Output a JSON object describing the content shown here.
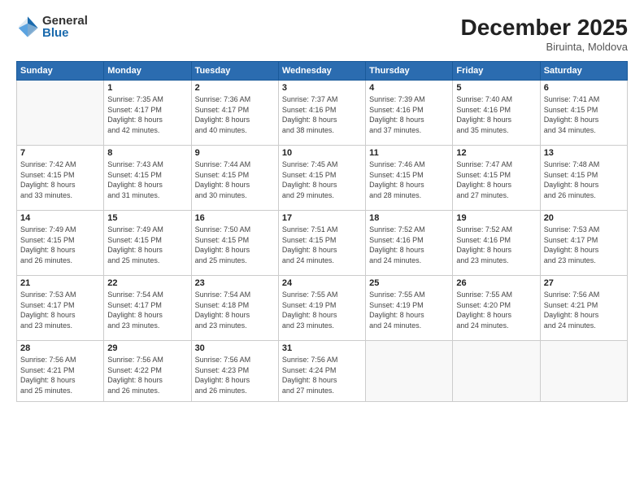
{
  "logo": {
    "general": "General",
    "blue": "Blue"
  },
  "title": "December 2025",
  "location": "Biruinta, Moldova",
  "days_header": [
    "Sunday",
    "Monday",
    "Tuesday",
    "Wednesday",
    "Thursday",
    "Friday",
    "Saturday"
  ],
  "weeks": [
    [
      {
        "day": "",
        "info": ""
      },
      {
        "day": "1",
        "info": "Sunrise: 7:35 AM\nSunset: 4:17 PM\nDaylight: 8 hours\nand 42 minutes."
      },
      {
        "day": "2",
        "info": "Sunrise: 7:36 AM\nSunset: 4:17 PM\nDaylight: 8 hours\nand 40 minutes."
      },
      {
        "day": "3",
        "info": "Sunrise: 7:37 AM\nSunset: 4:16 PM\nDaylight: 8 hours\nand 38 minutes."
      },
      {
        "day": "4",
        "info": "Sunrise: 7:39 AM\nSunset: 4:16 PM\nDaylight: 8 hours\nand 37 minutes."
      },
      {
        "day": "5",
        "info": "Sunrise: 7:40 AM\nSunset: 4:16 PM\nDaylight: 8 hours\nand 35 minutes."
      },
      {
        "day": "6",
        "info": "Sunrise: 7:41 AM\nSunset: 4:15 PM\nDaylight: 8 hours\nand 34 minutes."
      }
    ],
    [
      {
        "day": "7",
        "info": "Sunrise: 7:42 AM\nSunset: 4:15 PM\nDaylight: 8 hours\nand 33 minutes."
      },
      {
        "day": "8",
        "info": "Sunrise: 7:43 AM\nSunset: 4:15 PM\nDaylight: 8 hours\nand 31 minutes."
      },
      {
        "day": "9",
        "info": "Sunrise: 7:44 AM\nSunset: 4:15 PM\nDaylight: 8 hours\nand 30 minutes."
      },
      {
        "day": "10",
        "info": "Sunrise: 7:45 AM\nSunset: 4:15 PM\nDaylight: 8 hours\nand 29 minutes."
      },
      {
        "day": "11",
        "info": "Sunrise: 7:46 AM\nSunset: 4:15 PM\nDaylight: 8 hours\nand 28 minutes."
      },
      {
        "day": "12",
        "info": "Sunrise: 7:47 AM\nSunset: 4:15 PM\nDaylight: 8 hours\nand 27 minutes."
      },
      {
        "day": "13",
        "info": "Sunrise: 7:48 AM\nSunset: 4:15 PM\nDaylight: 8 hours\nand 26 minutes."
      }
    ],
    [
      {
        "day": "14",
        "info": "Sunrise: 7:49 AM\nSunset: 4:15 PM\nDaylight: 8 hours\nand 26 minutes."
      },
      {
        "day": "15",
        "info": "Sunrise: 7:49 AM\nSunset: 4:15 PM\nDaylight: 8 hours\nand 25 minutes."
      },
      {
        "day": "16",
        "info": "Sunrise: 7:50 AM\nSunset: 4:15 PM\nDaylight: 8 hours\nand 25 minutes."
      },
      {
        "day": "17",
        "info": "Sunrise: 7:51 AM\nSunset: 4:15 PM\nDaylight: 8 hours\nand 24 minutes."
      },
      {
        "day": "18",
        "info": "Sunrise: 7:52 AM\nSunset: 4:16 PM\nDaylight: 8 hours\nand 24 minutes."
      },
      {
        "day": "19",
        "info": "Sunrise: 7:52 AM\nSunset: 4:16 PM\nDaylight: 8 hours\nand 23 minutes."
      },
      {
        "day": "20",
        "info": "Sunrise: 7:53 AM\nSunset: 4:17 PM\nDaylight: 8 hours\nand 23 minutes."
      }
    ],
    [
      {
        "day": "21",
        "info": "Sunrise: 7:53 AM\nSunset: 4:17 PM\nDaylight: 8 hours\nand 23 minutes."
      },
      {
        "day": "22",
        "info": "Sunrise: 7:54 AM\nSunset: 4:17 PM\nDaylight: 8 hours\nand 23 minutes."
      },
      {
        "day": "23",
        "info": "Sunrise: 7:54 AM\nSunset: 4:18 PM\nDaylight: 8 hours\nand 23 minutes."
      },
      {
        "day": "24",
        "info": "Sunrise: 7:55 AM\nSunset: 4:19 PM\nDaylight: 8 hours\nand 23 minutes."
      },
      {
        "day": "25",
        "info": "Sunrise: 7:55 AM\nSunset: 4:19 PM\nDaylight: 8 hours\nand 24 minutes."
      },
      {
        "day": "26",
        "info": "Sunrise: 7:55 AM\nSunset: 4:20 PM\nDaylight: 8 hours\nand 24 minutes."
      },
      {
        "day": "27",
        "info": "Sunrise: 7:56 AM\nSunset: 4:21 PM\nDaylight: 8 hours\nand 24 minutes."
      }
    ],
    [
      {
        "day": "28",
        "info": "Sunrise: 7:56 AM\nSunset: 4:21 PM\nDaylight: 8 hours\nand 25 minutes."
      },
      {
        "day": "29",
        "info": "Sunrise: 7:56 AM\nSunset: 4:22 PM\nDaylight: 8 hours\nand 26 minutes."
      },
      {
        "day": "30",
        "info": "Sunrise: 7:56 AM\nSunset: 4:23 PM\nDaylight: 8 hours\nand 26 minutes."
      },
      {
        "day": "31",
        "info": "Sunrise: 7:56 AM\nSunset: 4:24 PM\nDaylight: 8 hours\nand 27 minutes."
      },
      {
        "day": "",
        "info": ""
      },
      {
        "day": "",
        "info": ""
      },
      {
        "day": "",
        "info": ""
      }
    ]
  ]
}
